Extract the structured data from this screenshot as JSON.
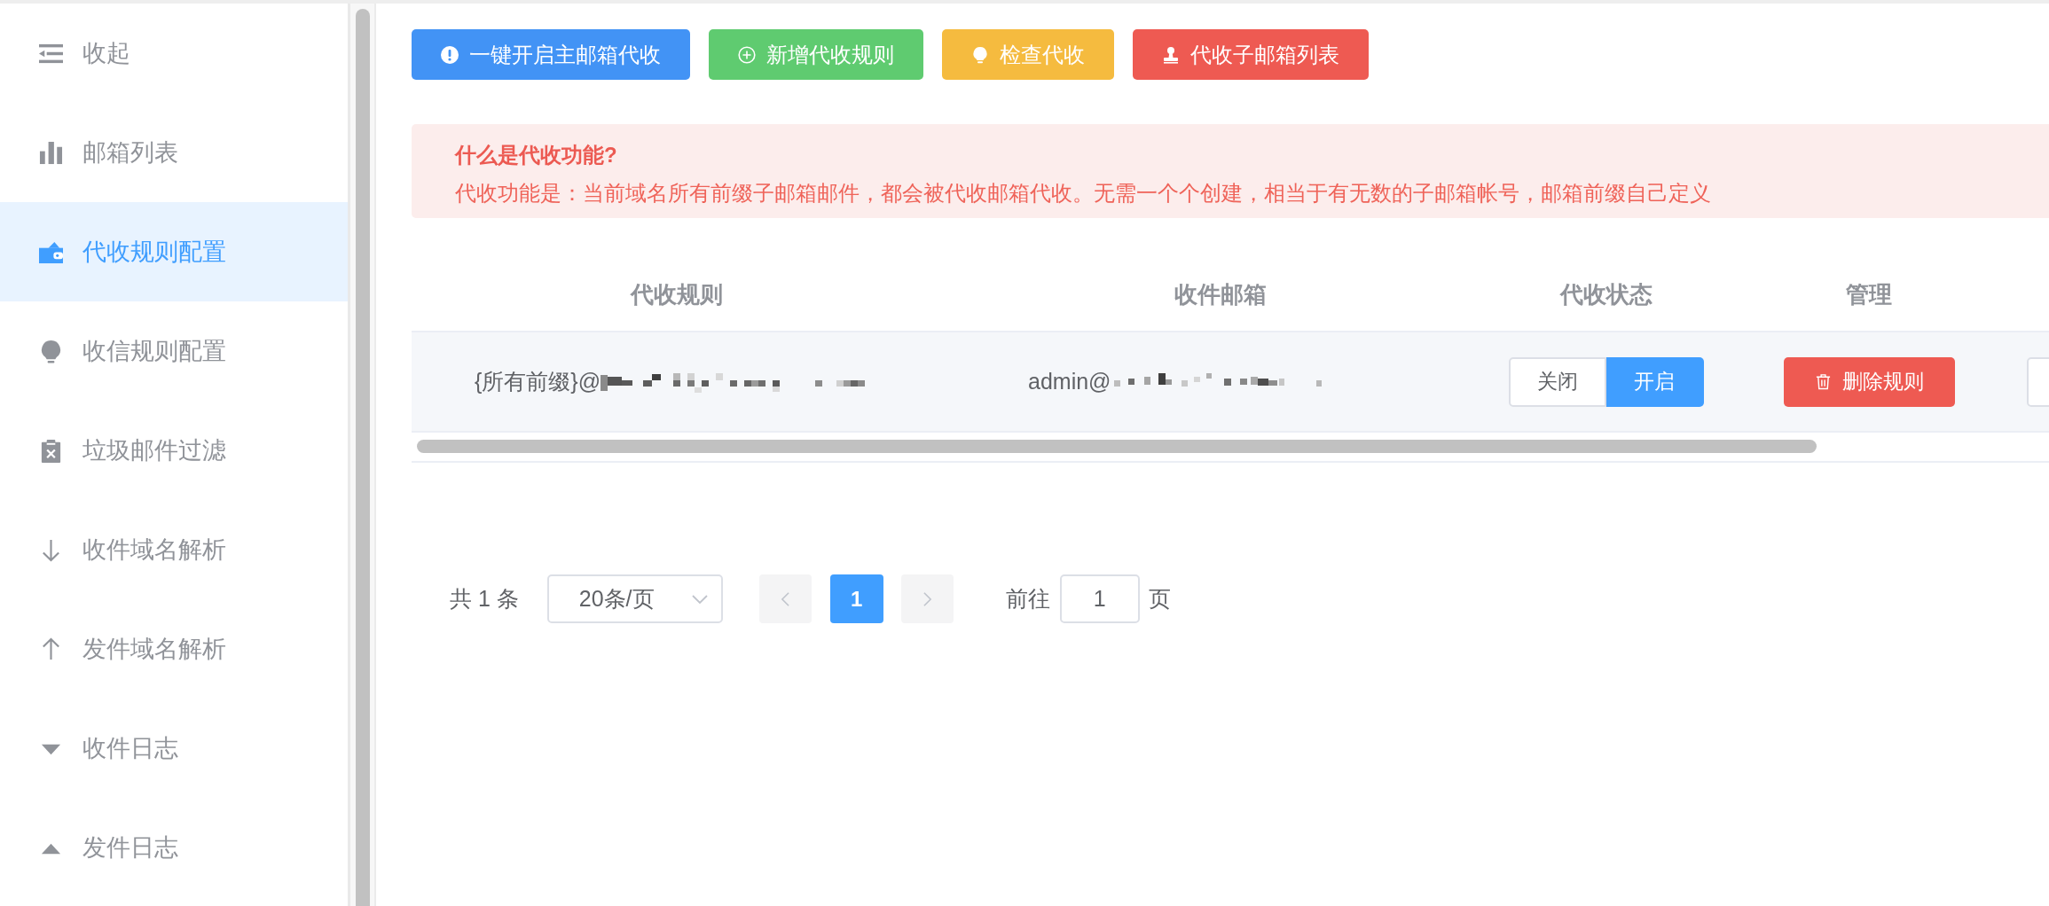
{
  "sidebar": {
    "items": [
      {
        "label": "收起",
        "selected": false
      },
      {
        "label": "邮箱列表",
        "selected": false
      },
      {
        "label": "代收规则配置",
        "selected": true
      },
      {
        "label": "收信规则配置",
        "selected": false
      },
      {
        "label": "垃圾邮件过滤",
        "selected": false
      },
      {
        "label": "收件域名解析",
        "selected": false
      },
      {
        "label": "发件域名解析",
        "selected": false
      },
      {
        "label": "收件日志",
        "selected": false
      },
      {
        "label": "发件日志",
        "selected": false
      }
    ]
  },
  "toolbar": {
    "buttons": [
      {
        "label": "一键开启主邮箱代收",
        "kind": "primary"
      },
      {
        "label": "新增代收规则",
        "kind": "success"
      },
      {
        "label": "检查代收",
        "kind": "warning"
      },
      {
        "label": "代收子邮箱列表",
        "kind": "danger"
      }
    ]
  },
  "alert": {
    "title": "什么是代收功能?",
    "description": "代收功能是：当前域名所有前缀子邮箱邮件，都会被代收邮箱代收。无需一个个创建，相当于有无数的子邮箱帐号，邮箱前缀自己定义"
  },
  "table": {
    "columns": [
      "代收规则",
      "收件邮箱",
      "代收状态",
      "管理"
    ],
    "rows": [
      {
        "rule": "{所有前缀}@",
        "rule_redacted": true,
        "mailbox": "admin@",
        "mailbox_redacted": true,
        "status": [
          {
            "label": "关闭",
            "selected": false
          },
          {
            "label": "开启",
            "selected": true
          }
        ],
        "action": "删除规则",
        "column_5": {
          "kind": "button"
        }
      }
    ]
  },
  "pagination": {
    "total": "共 1 条",
    "page_size": "20条/页",
    "prev": {
      "disabled": true
    },
    "pages": [
      {
        "label": "1",
        "selected": true
      }
    ],
    "next": {
      "disabled": true
    },
    "goto_label": "前往",
    "goto_value": "1",
    "goto_suffix": "页"
  }
}
